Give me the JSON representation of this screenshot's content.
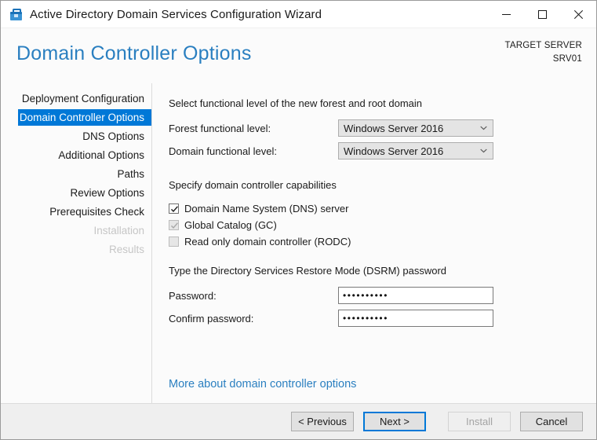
{
  "window": {
    "title": "Active Directory Domain Services Configuration Wizard",
    "icon": "server-toolbox-icon",
    "controls": {
      "minimize": "minimize-icon",
      "maximize": "maximize-icon",
      "close": "close-icon"
    }
  },
  "header": {
    "page_title": "Domain Controller Options",
    "target_server_label": "TARGET SERVER",
    "target_server_name": "SRV01"
  },
  "sidebar": {
    "items": [
      {
        "label": "Deployment Configuration",
        "state": "enabled"
      },
      {
        "label": "Domain Controller Options",
        "state": "selected"
      },
      {
        "label": "DNS Options",
        "state": "enabled"
      },
      {
        "label": "Additional Options",
        "state": "enabled"
      },
      {
        "label": "Paths",
        "state": "enabled"
      },
      {
        "label": "Review Options",
        "state": "enabled"
      },
      {
        "label": "Prerequisites Check",
        "state": "enabled"
      },
      {
        "label": "Installation",
        "state": "disabled"
      },
      {
        "label": "Results",
        "state": "disabled"
      }
    ]
  },
  "main": {
    "functional_level": {
      "section_label": "Select functional level of the new forest and root domain",
      "forest": {
        "label": "Forest functional level:",
        "value": "Windows Server 2016",
        "chevron": "chevron-down-icon"
      },
      "domain": {
        "label": "Domain functional level:",
        "value": "Windows Server 2016",
        "chevron": "chevron-down-icon"
      }
    },
    "capabilities": {
      "section_label": "Specify domain controller capabilities",
      "options": [
        {
          "label": "Domain Name System (DNS) server",
          "checked": true,
          "disabled": false
        },
        {
          "label": "Global Catalog (GC)",
          "checked": true,
          "disabled": true
        },
        {
          "label": "Read only domain controller (RODC)",
          "checked": false,
          "disabled": true
        }
      ]
    },
    "dsrm": {
      "section_label": "Type the Directory Services Restore Mode (DSRM) password",
      "password": {
        "label": "Password:",
        "value": "••••••••••",
        "placeholder": ""
      },
      "confirm": {
        "label": "Confirm password:",
        "value": "••••••••••",
        "placeholder": ""
      }
    },
    "more_link": "More about domain controller options"
  },
  "footer": {
    "previous": "< Previous",
    "next": "Next >",
    "install": "Install",
    "cancel": "Cancel"
  },
  "colors": {
    "accent": "#0078d7",
    "title_link": "#2a7fc0",
    "disabled_text": "#c6c6c6"
  }
}
